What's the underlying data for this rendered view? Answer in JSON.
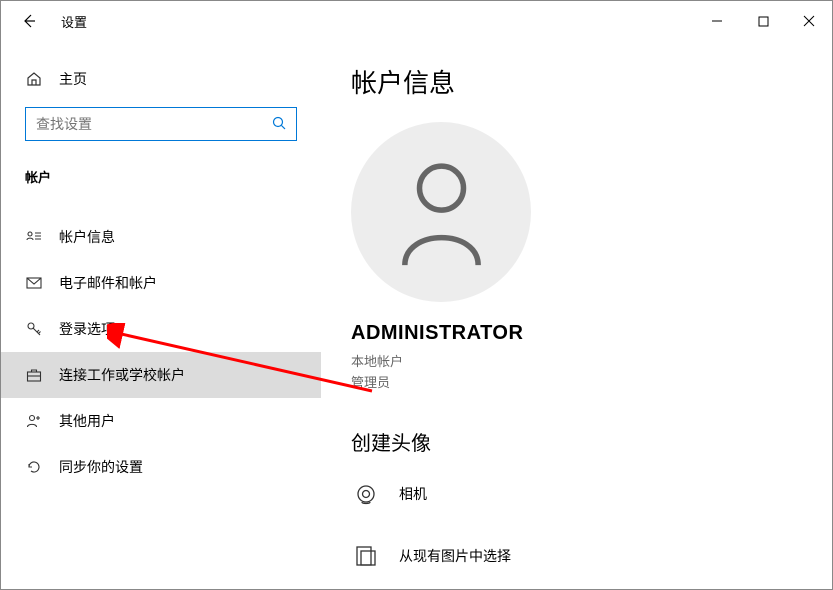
{
  "titlebar": {
    "title": "设置"
  },
  "sidebar": {
    "home_label": "主页",
    "search_placeholder": "查找设置",
    "section_label": "帐户",
    "items": [
      {
        "label": "帐户信息"
      },
      {
        "label": "电子邮件和帐户"
      },
      {
        "label": "登录选项"
      },
      {
        "label": "连接工作或学校帐户"
      },
      {
        "label": "其他用户"
      },
      {
        "label": "同步你的设置"
      }
    ]
  },
  "main": {
    "page_title": "帐户信息",
    "username": "ADMINISTRATOR",
    "account_type": "本地帐户",
    "role": "管理员",
    "create_avatar_title": "创建头像",
    "options": [
      {
        "label": "相机"
      },
      {
        "label": "从现有图片中选择"
      }
    ]
  }
}
